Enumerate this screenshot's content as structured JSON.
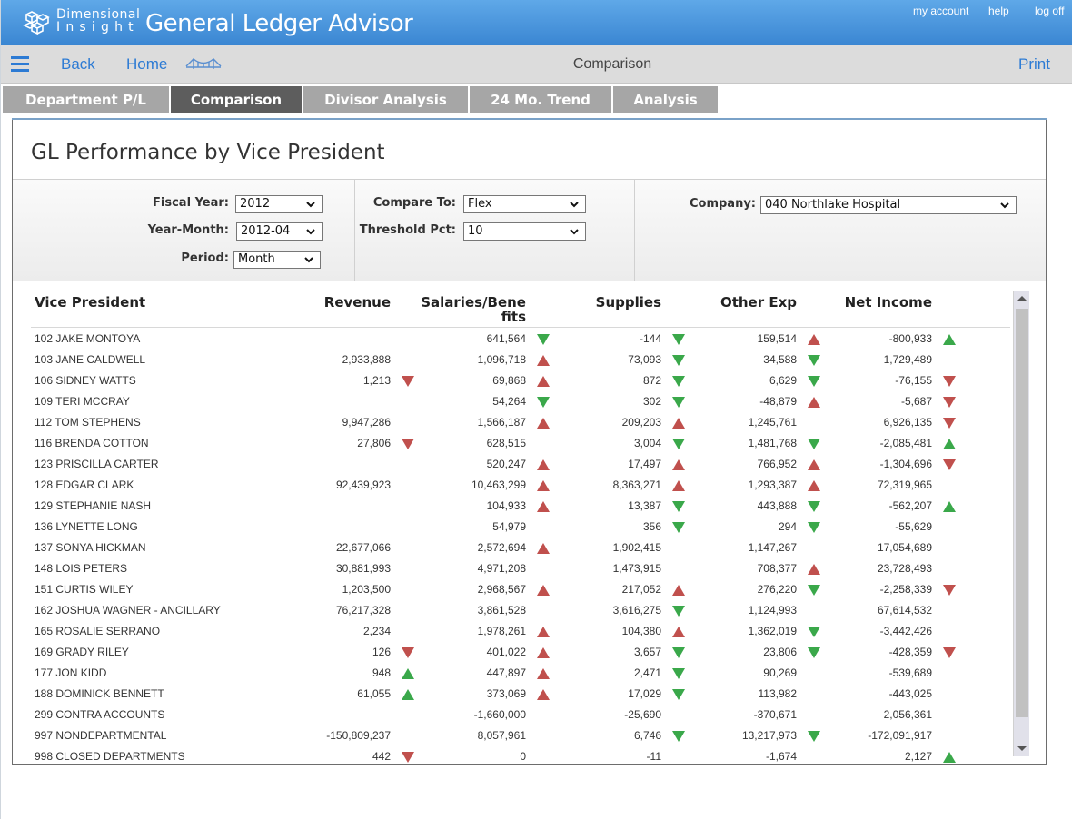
{
  "header": {
    "brand_line1": "Dimensional",
    "brand_line2": "Insight",
    "app_title": "General Ledger Advisor",
    "my_account": "my account",
    "help": "help",
    "log_off": "log off",
    "logo_icon": "cubes-logo-icon"
  },
  "nav": {
    "back": "Back",
    "home": "Home",
    "page_title": "Comparison",
    "print": "Print"
  },
  "tabs": [
    {
      "label": "Department P/L",
      "active": false
    },
    {
      "label": "Comparison",
      "active": true
    },
    {
      "label": "Divisor Analysis",
      "active": false
    },
    {
      "label": "24 Mo. Trend",
      "active": false
    },
    {
      "label": "Analysis",
      "active": false
    }
  ],
  "report": {
    "title": "GL Performance by Vice President"
  },
  "filters": {
    "fiscal_year_label": "Fiscal Year:",
    "fiscal_year": "2012",
    "year_month_label": "Year-Month:",
    "year_month": "2012-04",
    "period_label": "Period:",
    "period": "Month",
    "compare_to_label": "Compare To:",
    "compare_to": "Flex",
    "threshold_label": "Threshold Pct:",
    "threshold": "10",
    "company_label": "Company:",
    "company": "040 Northlake Hospital"
  },
  "columns": {
    "vp": "Vice President",
    "revenue": "Revenue",
    "salaries_1": "Salaries/Bene",
    "salaries_2": "fits",
    "supplies": "Supplies",
    "other": "Other Exp",
    "net": "Net Income"
  },
  "colors": {
    "up": "#3aa84a",
    "down": "#c0504d",
    "accent": "#2d7bd4"
  },
  "rows": [
    {
      "vp": "102 JAKE MONTOYA",
      "rev": "",
      "rev_i": "",
      "sal": "641,564",
      "sal_i": "gd",
      "sup": "-144",
      "sup_i": "gd",
      "oth": "159,514",
      "oth_i": "ru",
      "net": "-800,933",
      "net_i": "gu"
    },
    {
      "vp": "103 JANE CALDWELL",
      "rev": "2,933,888",
      "rev_i": "",
      "sal": "1,096,718",
      "sal_i": "ru",
      "sup": "73,093",
      "sup_i": "gd",
      "oth": "34,588",
      "oth_i": "gd",
      "net": "1,729,489",
      "net_i": ""
    },
    {
      "vp": "106 SIDNEY WATTS",
      "rev": "1,213",
      "rev_i": "rd",
      "sal": "69,868",
      "sal_i": "ru",
      "sup": "872",
      "sup_i": "gd",
      "oth": "6,629",
      "oth_i": "gd",
      "net": "-76,155",
      "net_i": "rd"
    },
    {
      "vp": "109 TERI MCCRAY",
      "rev": "",
      "rev_i": "",
      "sal": "54,264",
      "sal_i": "gd",
      "sup": "302",
      "sup_i": "gd",
      "oth": "-48,879",
      "oth_i": "ru",
      "net": "-5,687",
      "net_i": "rd"
    },
    {
      "vp": "112 TOM STEPHENS",
      "rev": "9,947,286",
      "rev_i": "",
      "sal": "1,566,187",
      "sal_i": "ru",
      "sup": "209,203",
      "sup_i": "ru",
      "oth": "1,245,761",
      "oth_i": "",
      "net": "6,926,135",
      "net_i": "rd"
    },
    {
      "vp": "116 BRENDA COTTON",
      "rev": "27,806",
      "rev_i": "rd",
      "sal": "628,515",
      "sal_i": "",
      "sup": "3,004",
      "sup_i": "gd",
      "oth": "1,481,768",
      "oth_i": "gd",
      "net": "-2,085,481",
      "net_i": "gu"
    },
    {
      "vp": "123 PRISCILLA CARTER",
      "rev": "",
      "rev_i": "",
      "sal": "520,247",
      "sal_i": "ru",
      "sup": "17,497",
      "sup_i": "ru",
      "oth": "766,952",
      "oth_i": "ru",
      "net": "-1,304,696",
      "net_i": "rd"
    },
    {
      "vp": "128 EDGAR CLARK",
      "rev": "92,439,923",
      "rev_i": "",
      "sal": "10,463,299",
      "sal_i": "ru",
      "sup": "8,363,271",
      "sup_i": "ru",
      "oth": "1,293,387",
      "oth_i": "ru",
      "net": "72,319,965",
      "net_i": ""
    },
    {
      "vp": "129 STEPHANIE NASH",
      "rev": "",
      "rev_i": "",
      "sal": "104,933",
      "sal_i": "ru",
      "sup": "13,387",
      "sup_i": "gd",
      "oth": "443,888",
      "oth_i": "gd",
      "net": "-562,207",
      "net_i": "gu"
    },
    {
      "vp": "136 LYNETTE LONG",
      "rev": "",
      "rev_i": "",
      "sal": "54,979",
      "sal_i": "",
      "sup": "356",
      "sup_i": "gd",
      "oth": "294",
      "oth_i": "gd",
      "net": "-55,629",
      "net_i": ""
    },
    {
      "vp": "137 SONYA HICKMAN",
      "rev": "22,677,066",
      "rev_i": "",
      "sal": "2,572,694",
      "sal_i": "ru",
      "sup": "1,902,415",
      "sup_i": "",
      "oth": "1,147,267",
      "oth_i": "",
      "net": "17,054,689",
      "net_i": ""
    },
    {
      "vp": "148 LOIS PETERS",
      "rev": "30,881,993",
      "rev_i": "",
      "sal": "4,971,208",
      "sal_i": "",
      "sup": "1,473,915",
      "sup_i": "",
      "oth": "708,377",
      "oth_i": "ru",
      "net": "23,728,493",
      "net_i": ""
    },
    {
      "vp": "151 CURTIS WILEY",
      "rev": "1,203,500",
      "rev_i": "",
      "sal": "2,968,567",
      "sal_i": "ru",
      "sup": "217,052",
      "sup_i": "ru",
      "oth": "276,220",
      "oth_i": "gd",
      "net": "-2,258,339",
      "net_i": "rd"
    },
    {
      "vp": "162 JOSHUA WAGNER - ANCILLARY",
      "rev": "76,217,328",
      "rev_i": "",
      "sal": "3,861,528",
      "sal_i": "",
      "sup": "3,616,275",
      "sup_i": "gd",
      "oth": "1,124,993",
      "oth_i": "",
      "net": "67,614,532",
      "net_i": ""
    },
    {
      "vp": "165 ROSALIE SERRANO",
      "rev": "2,234",
      "rev_i": "",
      "sal": "1,978,261",
      "sal_i": "ru",
      "sup": "104,380",
      "sup_i": "ru",
      "oth": "1,362,019",
      "oth_i": "gd",
      "net": "-3,442,426",
      "net_i": ""
    },
    {
      "vp": "169 GRADY RILEY",
      "rev": "126",
      "rev_i": "rd",
      "sal": "401,022",
      "sal_i": "ru",
      "sup": "3,657",
      "sup_i": "gd",
      "oth": "23,806",
      "oth_i": "gd",
      "net": "-428,359",
      "net_i": "rd"
    },
    {
      "vp": "177 JON KIDD",
      "rev": "948",
      "rev_i": "gu",
      "sal": "447,897",
      "sal_i": "ru",
      "sup": "2,471",
      "sup_i": "gd",
      "oth": "90,269",
      "oth_i": "",
      "net": "-539,689",
      "net_i": ""
    },
    {
      "vp": "188 DOMINICK BENNETT",
      "rev": "61,055",
      "rev_i": "gu",
      "sal": "373,069",
      "sal_i": "ru",
      "sup": "17,029",
      "sup_i": "gd",
      "oth": "113,982",
      "oth_i": "",
      "net": "-443,025",
      "net_i": ""
    },
    {
      "vp": "299 CONTRA ACCOUNTS",
      "rev": "",
      "rev_i": "",
      "sal": "-1,660,000",
      "sal_i": "",
      "sup": "-25,690",
      "sup_i": "",
      "oth": "-370,671",
      "oth_i": "",
      "net": "2,056,361",
      "net_i": ""
    },
    {
      "vp": "997 NONDEPARTMENTAL",
      "rev": "-150,809,237",
      "rev_i": "",
      "sal": "8,057,961",
      "sal_i": "",
      "sup": "6,746",
      "sup_i": "gd",
      "oth": "13,217,973",
      "oth_i": "gd",
      "net": "-172,091,917",
      "net_i": ""
    },
    {
      "vp": "998 CLOSED DEPARTMENTS",
      "rev": "442",
      "rev_i": "rd",
      "sal": "0",
      "sal_i": "",
      "sup": "-11",
      "sup_i": "",
      "oth": "-1,674",
      "oth_i": "",
      "net": "2,127",
      "net_i": "gu"
    }
  ]
}
